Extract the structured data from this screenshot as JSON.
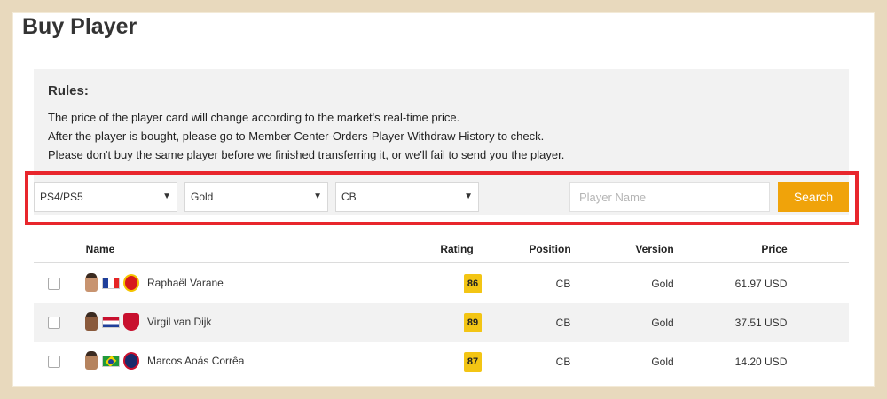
{
  "page": {
    "title": "Buy Player"
  },
  "rules": {
    "heading": "Rules:",
    "lines": [
      "The price of the player card will change according to the market's real-time price.",
      "After the player is bought, please go to Member Center-Orders-Player Withdraw History to check.",
      "Please don't buy the same player before we finished transferring it, or we'll fail to send you the player."
    ]
  },
  "filters": {
    "platform": "PS4/PS5",
    "version": "Gold",
    "position": "CB",
    "name_placeholder": "Player Name",
    "search_label": "Search"
  },
  "table": {
    "headers": {
      "name": "Name",
      "rating": "Rating",
      "position": "Position",
      "version": "Version",
      "price": "Price"
    },
    "rows": [
      {
        "name": "Raphaël Varane",
        "rating": "86",
        "position": "CB",
        "version": "Gold",
        "price": "61.97 USD",
        "flag": "france-flag",
        "club": "manchester-united-crest"
      },
      {
        "name": "Virgil van Dijk",
        "rating": "89",
        "position": "CB",
        "version": "Gold",
        "price": "37.51 USD",
        "flag": "netherlands-flag",
        "club": "liverpool-crest"
      },
      {
        "name": "Marcos Aoás Corrêa",
        "rating": "87",
        "position": "CB",
        "version": "Gold",
        "price": "14.20 USD",
        "flag": "brazil-flag",
        "club": "psg-crest"
      }
    ]
  },
  "colors": {
    "accent": "#f0a30a",
    "highlight": "#e8262c",
    "rating_badge": "#f3c514"
  }
}
